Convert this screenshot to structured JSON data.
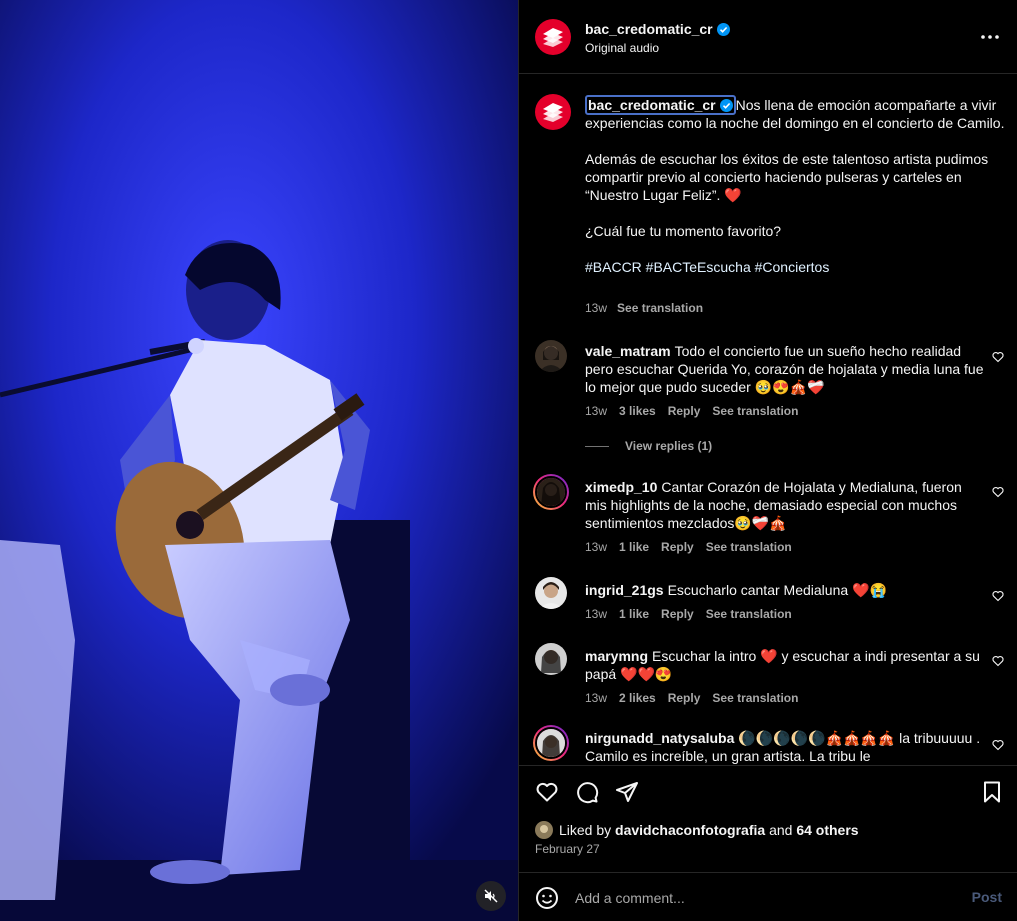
{
  "post": {
    "username": "bac_credomatic_cr",
    "audio": "Original audio",
    "caption": {
      "line1": "Nos llena de emoción acompañarte a vivir experiencias como la noche del domingo en el concierto de Camilo.",
      "line2": "Además de escuchar los éxitos de este talentoso artista pudimos compartir previo al concierto haciendo pulseras y carteles en “Nuestro Lugar Feliz”. ❤️",
      "line3": "¿Cuál fue tu momento favorito?",
      "hashtags": "#BACCR #BACTeEscucha #Conciertos",
      "time": "13w",
      "see_translation": "See translation"
    }
  },
  "comments": [
    {
      "username": "vale_matram",
      "text": "Todo el concierto fue un sueño hecho realidad pero escuchar Querida Yo, corazón de hojalata y media luna fue lo mejor que pudo suceder 🥹😍🎪❤️‍🩹",
      "time": "13w",
      "likes": "3 likes",
      "reply": "Reply",
      "see_translation": "See translation",
      "view_replies": "View replies (1)"
    },
    {
      "username": "ximedp_10",
      "text": "Cantar Corazón de Hojalata y Medialuna, fueron mis highlights de la noche, demasiado especial con muchos sentimientos mezclados🥹❤️‍🩹🎪",
      "time": "13w",
      "likes": "1 like",
      "reply": "Reply",
      "see_translation": "See translation"
    },
    {
      "username": "ingrid_21gs",
      "text": "Escucharlo cantar Medialuna ❤️😭",
      "time": "13w",
      "likes": "1 like",
      "reply": "Reply",
      "see_translation": "See translation"
    },
    {
      "username": "marymng",
      "text": "Escuchar la intro ❤️ y escuchar a indi presentar a su papá ❤️❤️😍",
      "time": "13w",
      "likes": "2 likes",
      "reply": "Reply",
      "see_translation": "See translation"
    },
    {
      "username": "nirgunadd_natysaluba",
      "text": "🌘🌘🌘🌘🌘🎪🎪🎪🎪 la tribuuuuu . Camilo es increíble, un gran artista. La tribu le"
    }
  ],
  "likes": {
    "prefix": "Liked by",
    "user": "davidchaconfotografia",
    "and": "and",
    "others": "64 others"
  },
  "date": "February 27",
  "add_comment": {
    "placeholder": "Add a comment...",
    "post": "Post"
  },
  "icons": {
    "verified": "verified-badge-icon",
    "more": "more-options-icon",
    "like": "heart-icon",
    "comment": "comment-icon",
    "share": "share-icon",
    "save": "bookmark-icon",
    "emoji": "emoji-icon",
    "mute": "muted-speaker-icon"
  },
  "colors": {
    "background": "#000000",
    "brand_red": "#e4002b",
    "verified_blue": "#0095f6",
    "secondary_text": "#a8a8a8",
    "stage_blue": "#1a2ad8"
  }
}
